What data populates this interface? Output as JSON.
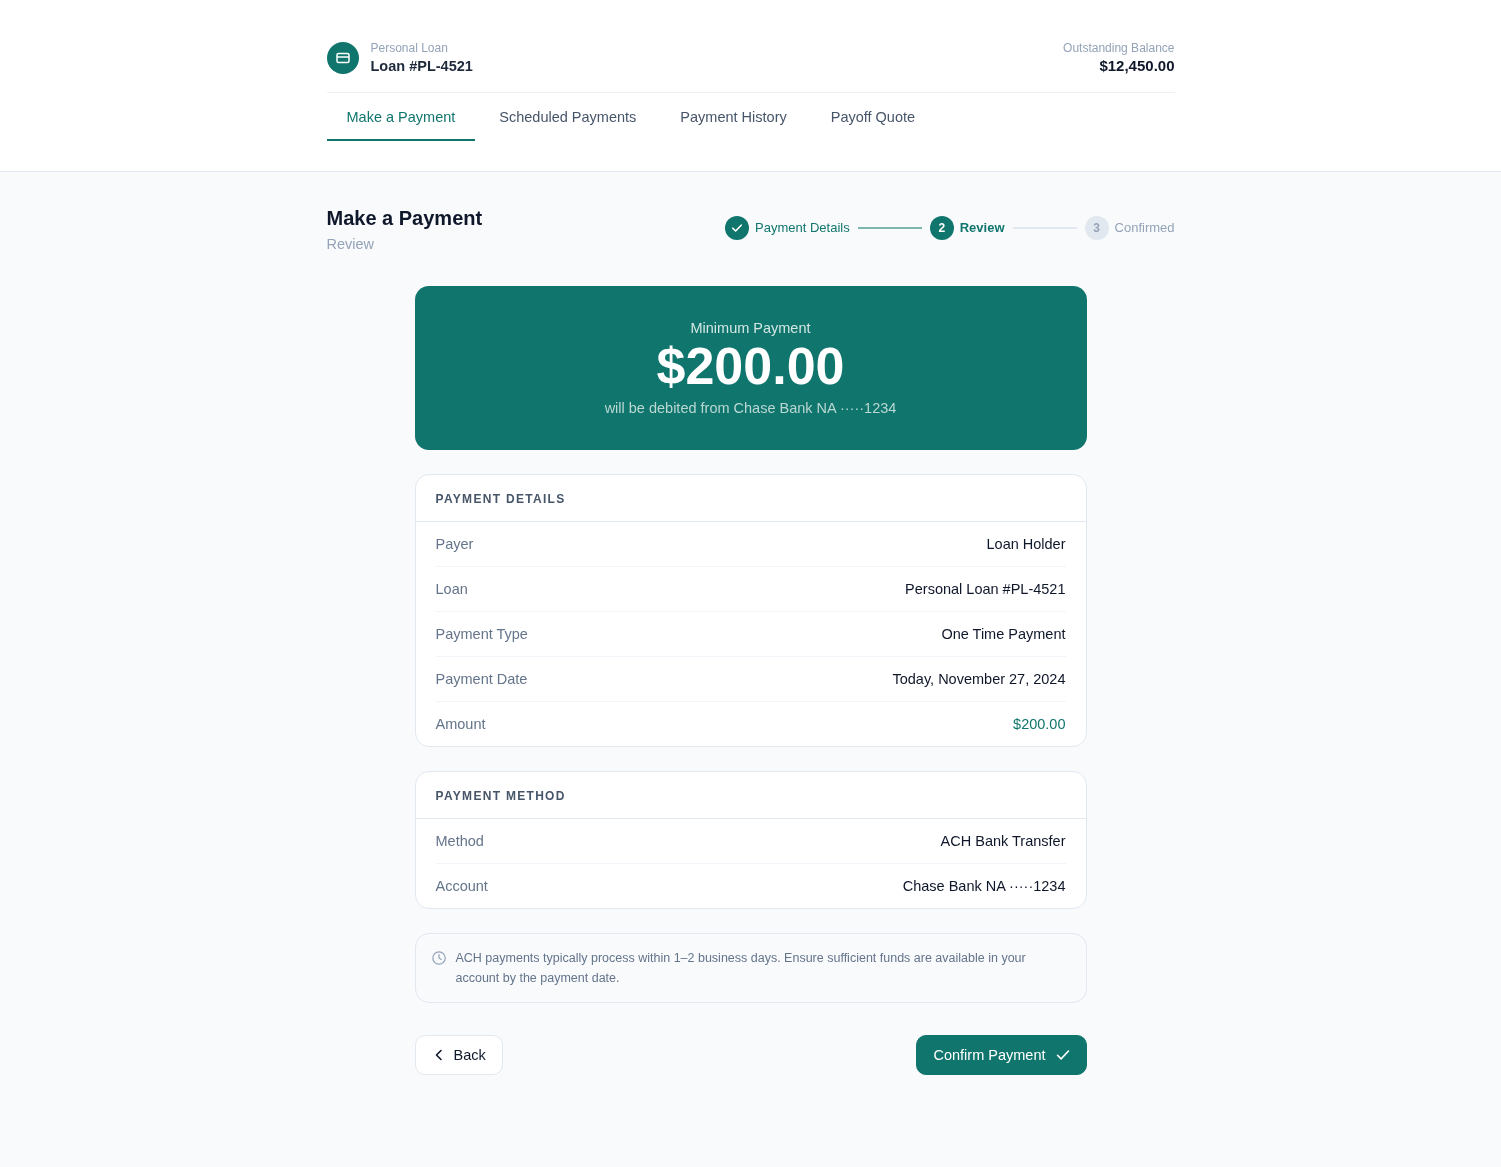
{
  "header": {
    "product": "Personal Loan",
    "loan": "Loan #PL-4521",
    "balance_label": "Outstanding Balance",
    "balance": "$12,450.00"
  },
  "tabs": [
    {
      "label": "Make a Payment",
      "selected": true
    },
    {
      "label": "Scheduled Payments",
      "selected": false
    },
    {
      "label": "Payment History",
      "selected": false
    },
    {
      "label": "Payoff Quote",
      "selected": false
    }
  ],
  "page": {
    "title": "Make a Payment",
    "subtitle": "Review"
  },
  "stepper": [
    {
      "label": "Payment Details",
      "completed": true,
      "current": false
    },
    {
      "number": "2",
      "label": "Review",
      "completed": false,
      "current": true
    },
    {
      "number": "3",
      "label": "Confirmed",
      "completed": false,
      "current": false
    }
  ],
  "summary": {
    "label": "Minimum Payment",
    "amount": "$200.00",
    "note": "will be debited from Chase Bank NA ·····1234"
  },
  "sections": [
    {
      "title": "PAYMENT DETAILS",
      "rows": [
        {
          "label": "Payer",
          "value": "Loan Holder",
          "highlight": false
        },
        {
          "label": "Loan",
          "value": "Personal Loan #PL-4521",
          "highlight": false
        },
        {
          "label": "Payment Type",
          "value": "One Time Payment",
          "highlight": false
        },
        {
          "label": "Payment Date",
          "value": "Today, November 27, 2024",
          "highlight": false
        },
        {
          "label": "Amount",
          "value": "$200.00",
          "highlight": true
        }
      ]
    },
    {
      "title": "PAYMENT METHOD",
      "rows": [
        {
          "label": "Method",
          "value": "ACH Bank Transfer",
          "highlight": false
        },
        {
          "label": "Account",
          "value": "Chase Bank NA ·····1234",
          "highlight": false
        }
      ]
    }
  ],
  "notice": "ACH payments typically process within 1–2 business days. Ensure sufficient funds are available in your account by the payment date.",
  "actions": {
    "back": "Back",
    "confirm": "Confirm Payment"
  }
}
